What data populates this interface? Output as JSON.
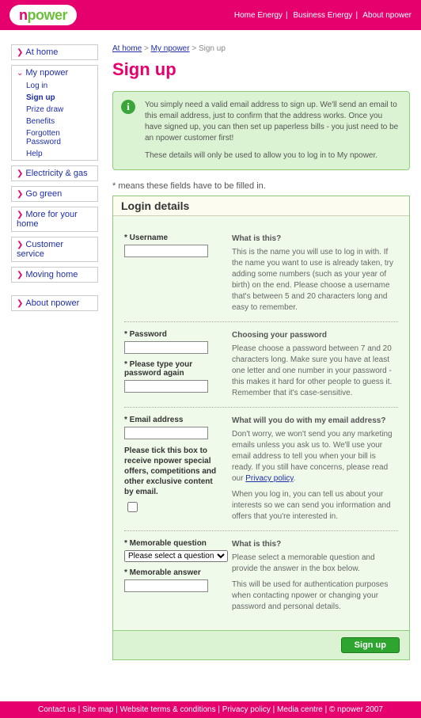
{
  "top": {
    "links": [
      "Home Energy",
      "Business Energy",
      "About npower"
    ]
  },
  "side": {
    "athome": "At home",
    "my": "My npower",
    "subs": [
      "Log in",
      "Sign up",
      "Prize draw",
      "Benefits",
      "Forgotten Password",
      "Help"
    ],
    "active_sub": 1,
    "items": [
      "Electricity & gas",
      "Go green",
      "More for your home",
      "Customer service",
      "Moving home"
    ],
    "about": "About npower"
  },
  "crumb": {
    "a": "At home",
    "b": "My npower",
    "c": "Sign up"
  },
  "h1": "Sign up",
  "info": {
    "p1": "You simply need a valid email address to sign up. We'll send an email to this email address, just to confirm that the address works. Once you have signed up, you can then set up paperless bills - you just need to be an npower customer first!",
    "p2": "These details will only be used to allow you to log in to My npower."
  },
  "note": "* means these fields have to be filled in.",
  "section_title": "Login details",
  "labels": {
    "username": "* Username",
    "password": "* Password",
    "password2": "* Please type your password again",
    "email": "* Email address",
    "offers": "Please tick this box to receive npower special offers, competitions and other exclusive content by email.",
    "question": "* Memorable question",
    "answer": "* Memorable answer"
  },
  "select_default": "Please select a question",
  "help": {
    "u_t": "What is this?",
    "u_b": "This is the name you will use to log in with. If the name you want to use is already taken, try adding some numbers (such as your year of birth) on the end. Please choose a username that's between 5 and 20 characters long and easy to remember.",
    "p_t": "Choosing your password",
    "p_b": "Please choose a password between 7 and 20 characters long. Make sure you have at least one letter and one number in your password - this makes it hard for other people to guess it. Remember that it's case-sensitive.",
    "e_t": "What will you do with my email address?",
    "e_b1": "Don't worry, we won't send you any marketing emails unless you ask us to. We'll use your email address to tell you when your bill is ready. If you still have concerns, please read our ",
    "e_link": "Privacy policy",
    "e_b2": "When you log in, you can tell us about your interests so we can send you information and offers that you're interested in.",
    "q_t": "What is this?",
    "q_b1": "Please select a memorable question and provide the answer in the box below.",
    "q_b2": "This will be used for authentication purposes when contacting npower or changing your password and personal details."
  },
  "button": "Sign up",
  "footer": [
    "Contact us",
    "Site map",
    "Website terms & conditions",
    "Privacy policy",
    "Media centre",
    "© npower 2007"
  ]
}
